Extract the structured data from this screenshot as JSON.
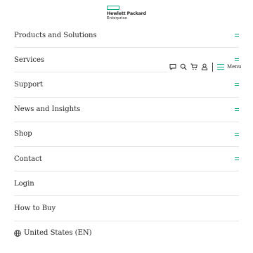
{
  "brand": {
    "line1": "Hewlett Packard",
    "line2": "Enterprise",
    "accent_color": "#01a982"
  },
  "toolbar": {
    "icons": [
      "chat-icon",
      "search-icon",
      "cart-icon",
      "user-icon"
    ],
    "menu_label": "Menu"
  },
  "nav": {
    "items": [
      {
        "label": "Products and Solutions",
        "expandable": true
      },
      {
        "label": "Services",
        "expandable": true
      },
      {
        "label": "Support",
        "expandable": true
      },
      {
        "label": "News and Insights",
        "expandable": true
      },
      {
        "label": "Shop",
        "expandable": true
      },
      {
        "label": "Contact",
        "expandable": true
      },
      {
        "label": "Login",
        "expandable": false
      },
      {
        "label": "How to Buy",
        "expandable": false
      },
      {
        "label": "United States (EN)",
        "expandable": false,
        "icon": "globe-icon"
      }
    ]
  }
}
